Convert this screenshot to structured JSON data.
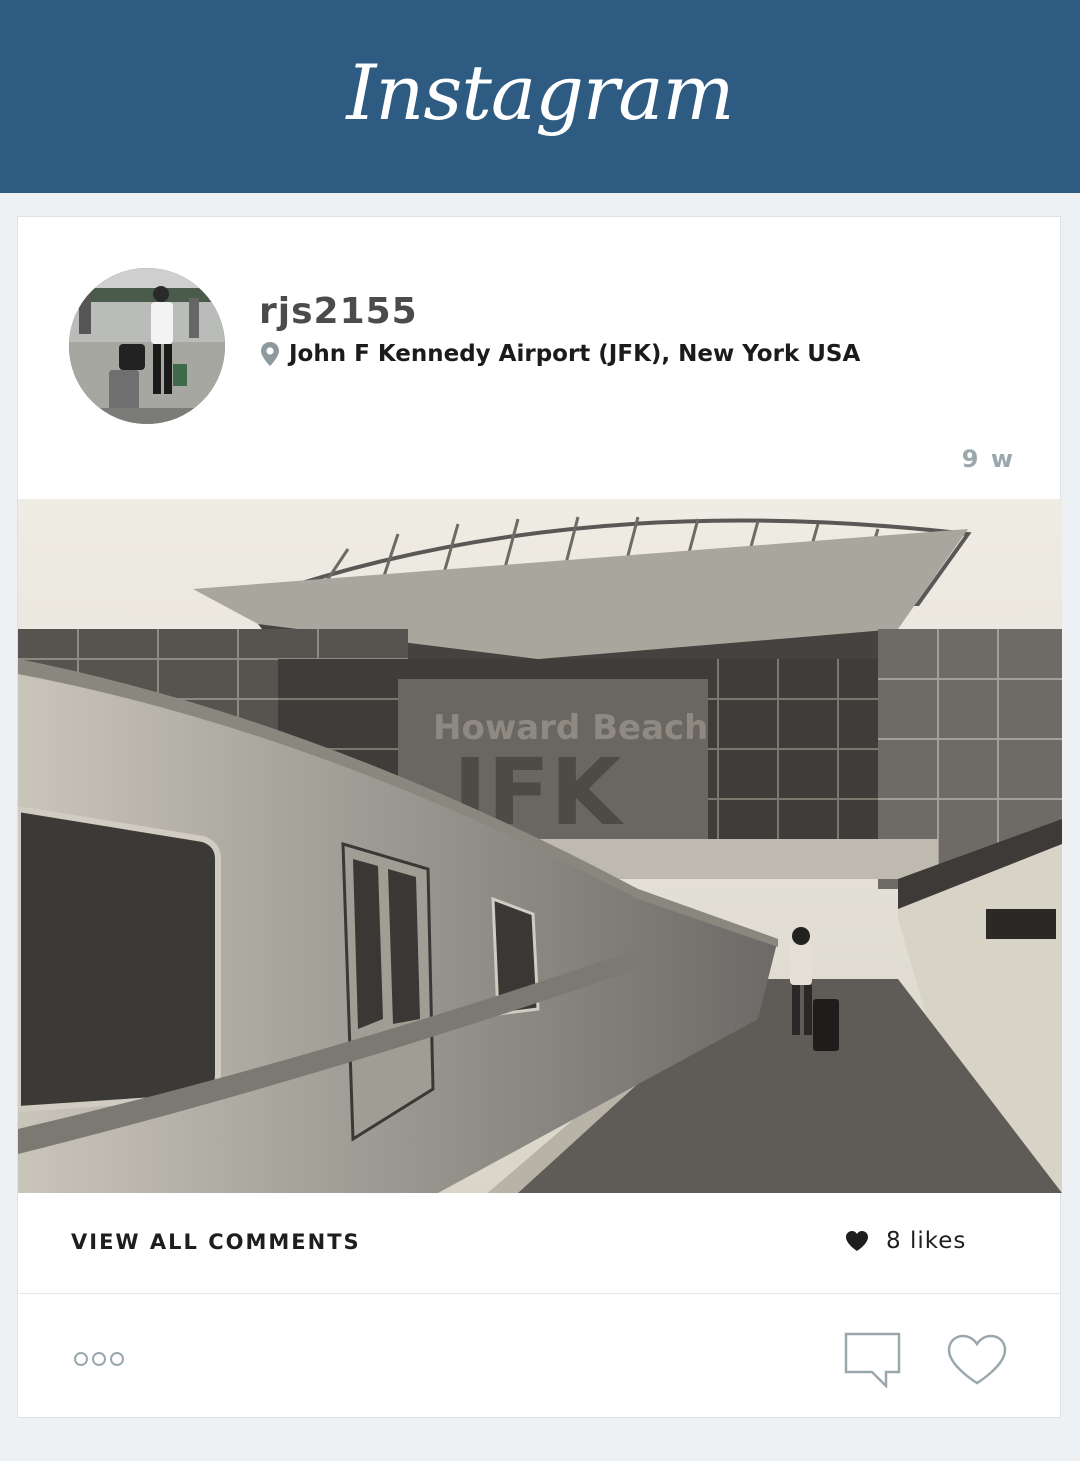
{
  "app": {
    "title": "Instagram"
  },
  "post": {
    "username": "rjs2155",
    "location": "John F Kennedy Airport (JFK), New York USA",
    "time_ago": "9 w",
    "photo_sign_1": "Howard Beach",
    "photo_sign_2": "JFK",
    "view_comments_label": "VIEW ALL COMMENTS",
    "likes_label": "8 likes"
  },
  "icons": {
    "location": "location-pin-icon",
    "likes": "heart-filled-icon",
    "more": "more-dots-icon",
    "comment": "comment-bubble-icon",
    "like": "heart-outline-icon"
  },
  "colors": {
    "header": "#2d5b82",
    "background": "#eef1f4",
    "muted": "#9aa8ad",
    "text": "#1e1e1e"
  }
}
